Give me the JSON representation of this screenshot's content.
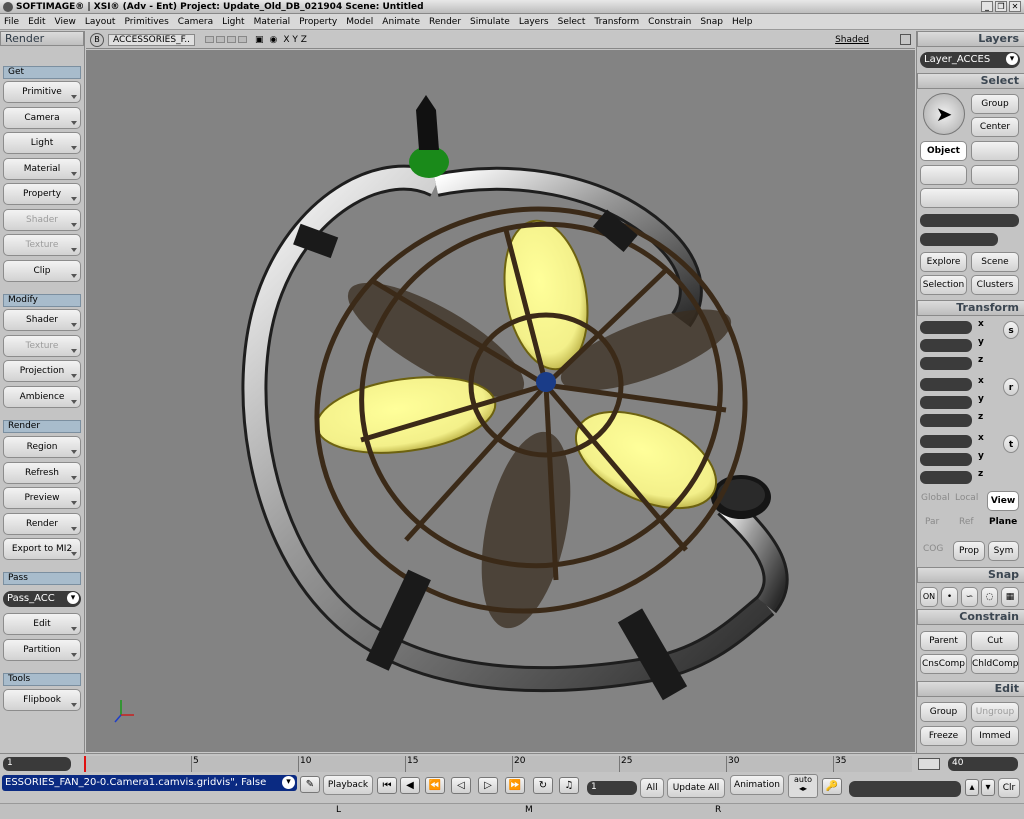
{
  "app": {
    "title": "SOFTIMAGE® | XSI® (Adv - Ent) Project: Update_Old_DB_021904    Scene: Untitled"
  },
  "menu": [
    "File",
    "Edit",
    "View",
    "Layout",
    "Primitives",
    "Camera",
    "Light",
    "Material",
    "Property",
    "Model",
    "Animate",
    "Render",
    "Simulate",
    "Layers",
    "Select",
    "Transform",
    "Constrain",
    "Snap",
    "Help"
  ],
  "left_panel": {
    "title": "Render",
    "get": {
      "label": "Get",
      "items": [
        "Primitive",
        "Camera",
        "Light",
        "Material",
        "Property",
        "Shader",
        "Texture",
        "Clip"
      ]
    },
    "modify": {
      "label": "Modify",
      "items": [
        "Shader",
        "Texture",
        "Projection",
        "Ambience"
      ]
    },
    "render": {
      "label": "Render",
      "items": [
        "Region",
        "Refresh",
        "Preview",
        "Render",
        "Export to MI2"
      ]
    },
    "pass": {
      "label": "Pass",
      "dropdown": "Pass_ACC",
      "items": [
        "Edit",
        "Partition"
      ]
    },
    "tools": {
      "label": "Tools",
      "items": [
        "Flipbook"
      ]
    }
  },
  "viewport": {
    "camera": "ACCESSORIES_F..",
    "axes": "X Y Z",
    "mode": "Shaded",
    "b_badge": "B"
  },
  "right_panel": {
    "layers": {
      "title": "Layers",
      "dropdown": "Layer_ACCES"
    },
    "select": {
      "title": "Select",
      "group": "Group",
      "center": "Center",
      "object": "Object",
      "explore": "Explore",
      "scene": "Scene",
      "selection": "Selection",
      "clusters": "Clusters"
    },
    "transform": {
      "title": "Transform",
      "axes": [
        "x",
        "y",
        "z"
      ],
      "sections": [
        "s",
        "r",
        "t"
      ],
      "global": "Global",
      "local": "Local",
      "view": "View",
      "par": "Par",
      "ref": "Ref",
      "plane": "Plane",
      "cog": "COG",
      "prop": "Prop",
      "sym": "Sym"
    },
    "snap": {
      "title": "Snap",
      "on": "ON"
    },
    "constrain": {
      "title": "Constrain",
      "parent": "Parent",
      "cut": "Cut",
      "cnscomp": "CnsComp",
      "chldcomp": "ChldComp"
    },
    "edit": {
      "title": "Edit",
      "group": "Group",
      "ungroup": "Ungroup",
      "freeze": "Freeze",
      "immed": "Immed"
    }
  },
  "timeline": {
    "start": "1",
    "end": "40",
    "ticks": [
      "5",
      "10",
      "15",
      "20",
      "25",
      "30",
      "35"
    ]
  },
  "bottom": {
    "command": "ESSORIES_FAN_20-0.Camera1.camvis.gridvis\", False",
    "playback": "Playback",
    "frame": "1",
    "all": "All",
    "update_all": "Update All",
    "animation": "Animation",
    "auto": "auto",
    "clr": "Clr"
  },
  "status": {
    "l": "L",
    "m": "M",
    "r": "R"
  }
}
